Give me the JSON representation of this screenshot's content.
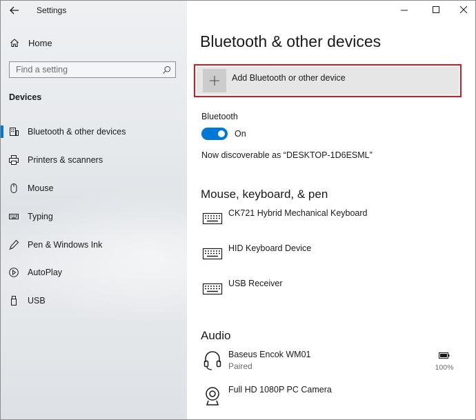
{
  "window": {
    "title": "Settings",
    "controls": [
      "minimize-icon",
      "maximize-icon",
      "close-icon"
    ]
  },
  "sidebar": {
    "home_label": "Home",
    "search_placeholder": "Find a setting",
    "section_heading": "Devices",
    "items": [
      {
        "label": "Bluetooth & other devices",
        "icon": "bluetooth-devices-icon",
        "selected": true
      },
      {
        "label": "Printers & scanners",
        "icon": "printer-icon",
        "selected": false
      },
      {
        "label": "Mouse",
        "icon": "mouse-icon",
        "selected": false
      },
      {
        "label": "Typing",
        "icon": "keyboard-icon",
        "selected": false
      },
      {
        "label": "Pen & Windows Ink",
        "icon": "pen-icon",
        "selected": false
      },
      {
        "label": "AutoPlay",
        "icon": "autoplay-icon",
        "selected": false
      },
      {
        "label": "USB",
        "icon": "usb-icon",
        "selected": false
      }
    ]
  },
  "main": {
    "title": "Bluetooth & other devices",
    "add_device_label": "Add Bluetooth or other device",
    "bluetooth": {
      "label": "Bluetooth",
      "toggle_state": "On",
      "enabled": true,
      "discoverable_text": "Now discoverable as “DESKTOP-1D6ESML”"
    },
    "groups": {
      "input": {
        "heading": "Mouse, keyboard, & pen",
        "devices": [
          {
            "name": "CK721 Hybrid Mechanical Keyboard",
            "icon": "keyboard-icon"
          },
          {
            "name": "HID Keyboard Device",
            "icon": "keyboard-icon"
          },
          {
            "name": "USB Receiver",
            "icon": "keyboard-icon"
          }
        ]
      },
      "audio": {
        "heading": "Audio",
        "devices": [
          {
            "name": "Baseus Encok WM01",
            "status": "Paired",
            "battery": "100%",
            "icon": "headset-icon"
          },
          {
            "name": "Full HD 1080P PC Camera",
            "status": "",
            "icon": "webcam-icon"
          }
        ]
      }
    }
  },
  "colors": {
    "accent": "#0078d7",
    "highlight_border": "#e0151b",
    "sidebar_bg": "#e6e9ec"
  }
}
